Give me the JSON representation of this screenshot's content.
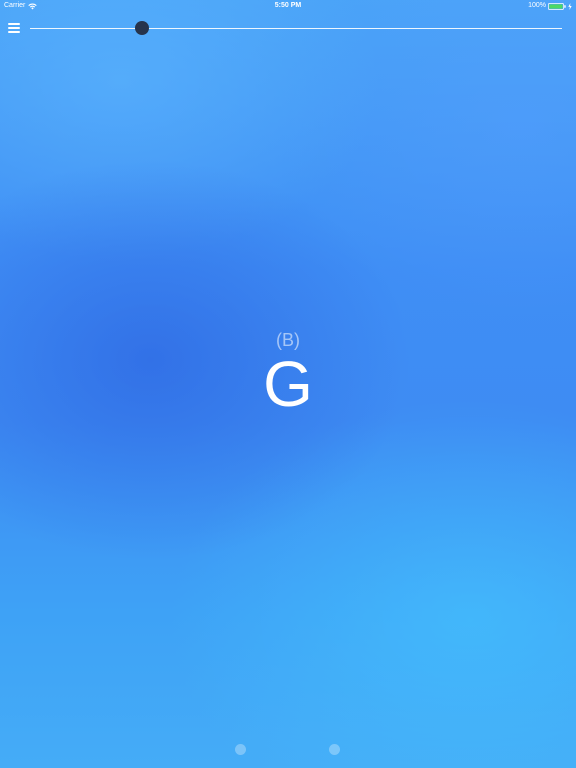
{
  "status_bar": {
    "carrier": "Carrier",
    "time": "5:50 PM",
    "battery": "100%",
    "wifi_icon": "wifi-icon",
    "battery_icon": "battery-icon",
    "charge_icon": "charging-bolt-icon",
    "battery_fill_color": "#4cd964"
  },
  "toolbar": {
    "menu_icon": "hamburger-menu-icon",
    "slider": {
      "value": 0.21,
      "thumb_color": "#26344c",
      "track_color": "#ffffff"
    }
  },
  "note": {
    "alternate": "(B)",
    "main": "G"
  },
  "page_indicator": {
    "pages": 2
  },
  "colors": {
    "background_top": "#4aa3f8",
    "background_mid": "#3e8cf3",
    "background_bottom": "#45acf7",
    "text": "#ffffff"
  }
}
